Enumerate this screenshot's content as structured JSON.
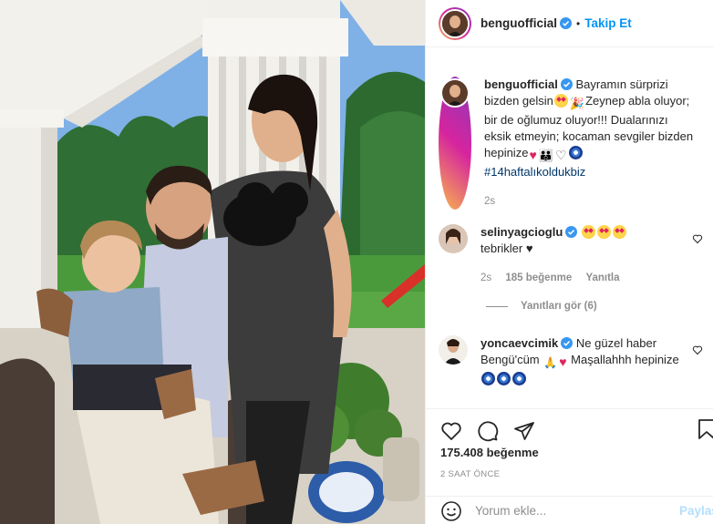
{
  "post": {
    "image_alt": "Family photo on a terrace",
    "author": {
      "username": "benguofficial",
      "verified": true,
      "follow_label": "Takip Et",
      "separator": "•"
    },
    "caption": {
      "username": "benguofficial",
      "text_line1": " Bayramın sürprizi bizden gelsin",
      "text_line2": "Zeynep abla oluyor; bir de oğlumuz oluyor!!! Dualarınızı eksik etmeyin; kocaman sevgiler bizden hepinize",
      "hashtag": "#14haftalıkoldukbiz",
      "age": "2s"
    },
    "comments": [
      {
        "username": "selinyagcioglu",
        "verified": true,
        "text": "tebrikler ♥",
        "age": "2s",
        "likes": "185 beğenme",
        "reply_label": "Yanıtla",
        "view_replies": "Yanıtları gör (6)"
      },
      {
        "username": "yoncaevcimik",
        "verified": true,
        "text_a": " Ne güzel haber Bengü'cüm",
        "text_b": "Maşallahhh hepinize"
      }
    ],
    "likes": "175.408 beğenme",
    "timestamp": "2 SAAT ÖNCE",
    "comment_input": {
      "placeholder": "Yorum ekle...",
      "post_label": "Paylaş"
    }
  },
  "icons": [
    "verified-badge-icon",
    "heart-icon",
    "comment-icon",
    "share-icon",
    "bookmark-icon",
    "emoji-icon",
    "heart-small-icon"
  ],
  "colors": {
    "link": "#0095f6",
    "hashtag": "#00376b",
    "muted": "#8e8e8e",
    "text": "#262626",
    "post_disabled": "#b2dffc"
  }
}
